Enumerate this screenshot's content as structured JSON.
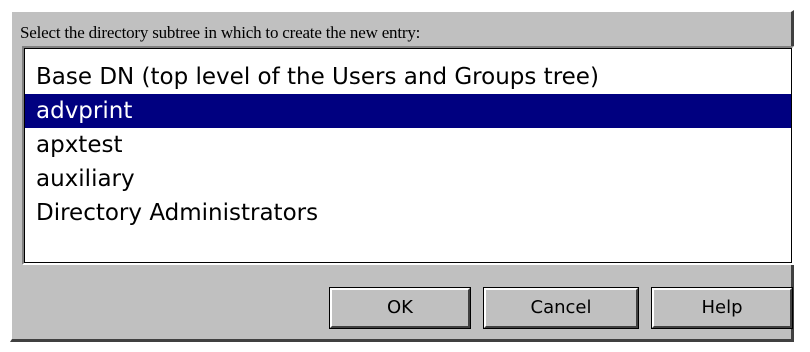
{
  "prompt": "Select the directory subtree in which to create the new entry:",
  "list": {
    "items": [
      "Base DN (top level of the Users and Groups tree)",
      "advprint",
      "apxtest",
      "auxiliary",
      "Directory Administrators"
    ],
    "selected": "advprint"
  },
  "buttons": {
    "ok": "OK",
    "cancel": "Cancel",
    "help": "Help"
  },
  "colors": {
    "dialog_bg": "#c0c0c0",
    "selection_bg": "#000080",
    "selection_text": "#ffffff"
  }
}
